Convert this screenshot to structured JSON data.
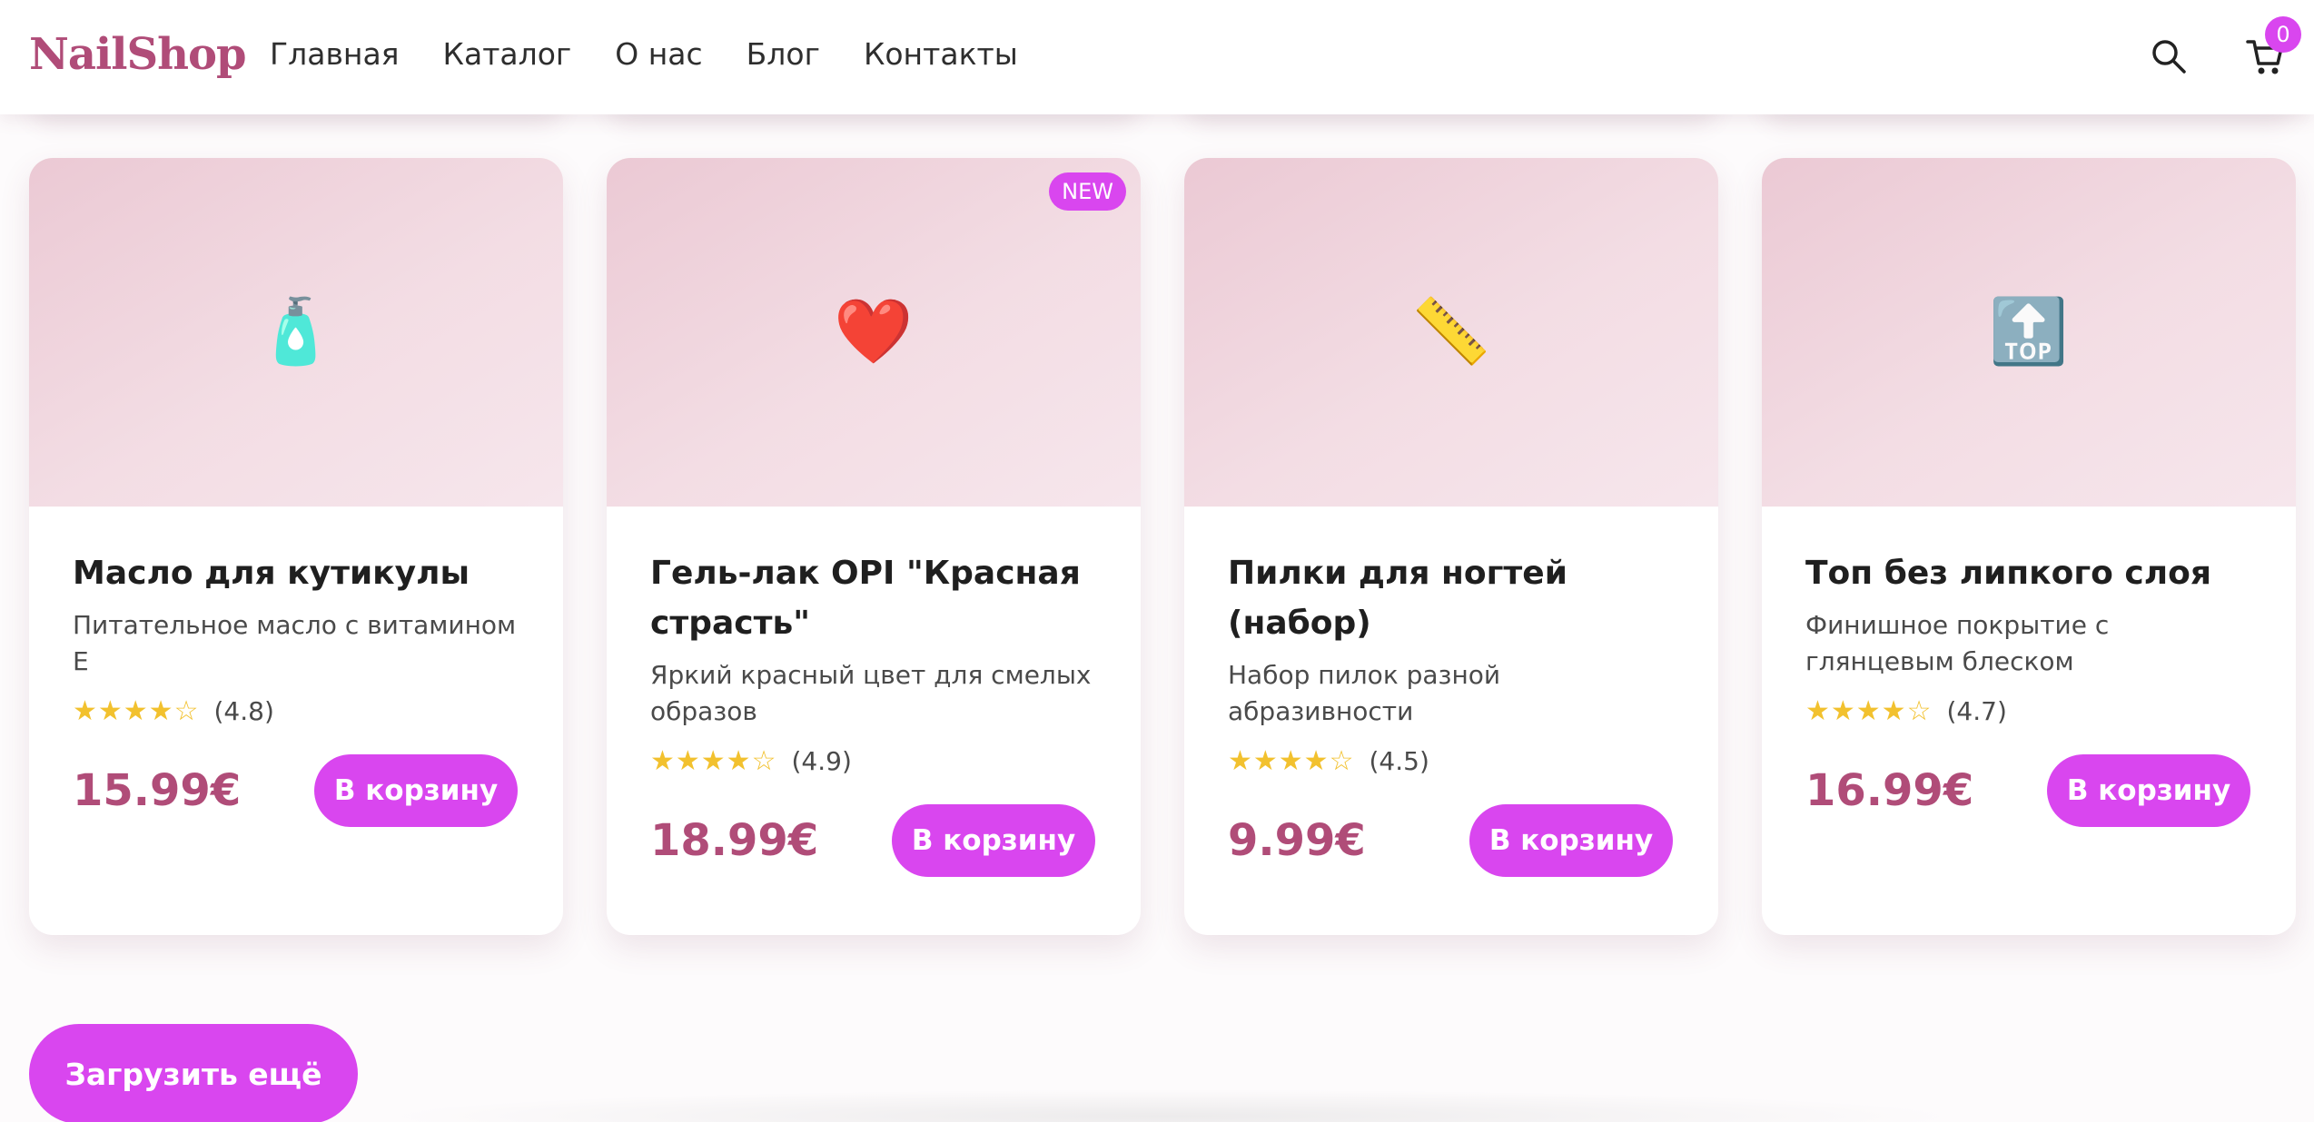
{
  "header": {
    "logo": "NailShop",
    "nav": [
      "Главная",
      "Каталог",
      "О нас",
      "Блог",
      "Контакты"
    ],
    "cart_count": "0",
    "icons": {
      "search": "search-icon",
      "cart": "cart-icon"
    }
  },
  "products": [
    {
      "image_icon": "🧴",
      "image_icon_name": "lotion-bottle-icon",
      "name": "Масло для кутикулы",
      "description": "Питательное масло с витамином Е",
      "stars": "★★★★☆",
      "rating": "(4.8)",
      "price": "15.99€",
      "button": "В корзину"
    },
    {
      "image_icon": "❤️",
      "image_icon_name": "heart-icon",
      "badge": "NEW",
      "name": "Гель-лак OPI \"Красная страсть\"",
      "description": "Яркий красный цвет для смелых образов",
      "stars": "★★★★☆",
      "rating": "(4.9)",
      "price": "18.99€",
      "button": "В корзину"
    },
    {
      "image_icon": "📏",
      "image_icon_name": "nail-file-icon",
      "name": "Пилки для ногтей (набор)",
      "description": "Набор пилок разной абразивности",
      "stars": "★★★★☆",
      "rating": "(4.5)",
      "price": "9.99€",
      "button": "В корзину"
    },
    {
      "image_icon": "🔝",
      "image_icon_name": "top-arrow-icon",
      "name": "Топ без липкого слоя",
      "description": "Финишное покрытие с глянцевым блеском",
      "stars": "★★★★☆",
      "rating": "(4.7)",
      "price": "16.99€",
      "button": "В корзину"
    }
  ],
  "load_more": "Загрузить ещё",
  "colors": {
    "accent": "#d946ef",
    "brand": "#b04c78",
    "star": "#f2c12e"
  }
}
